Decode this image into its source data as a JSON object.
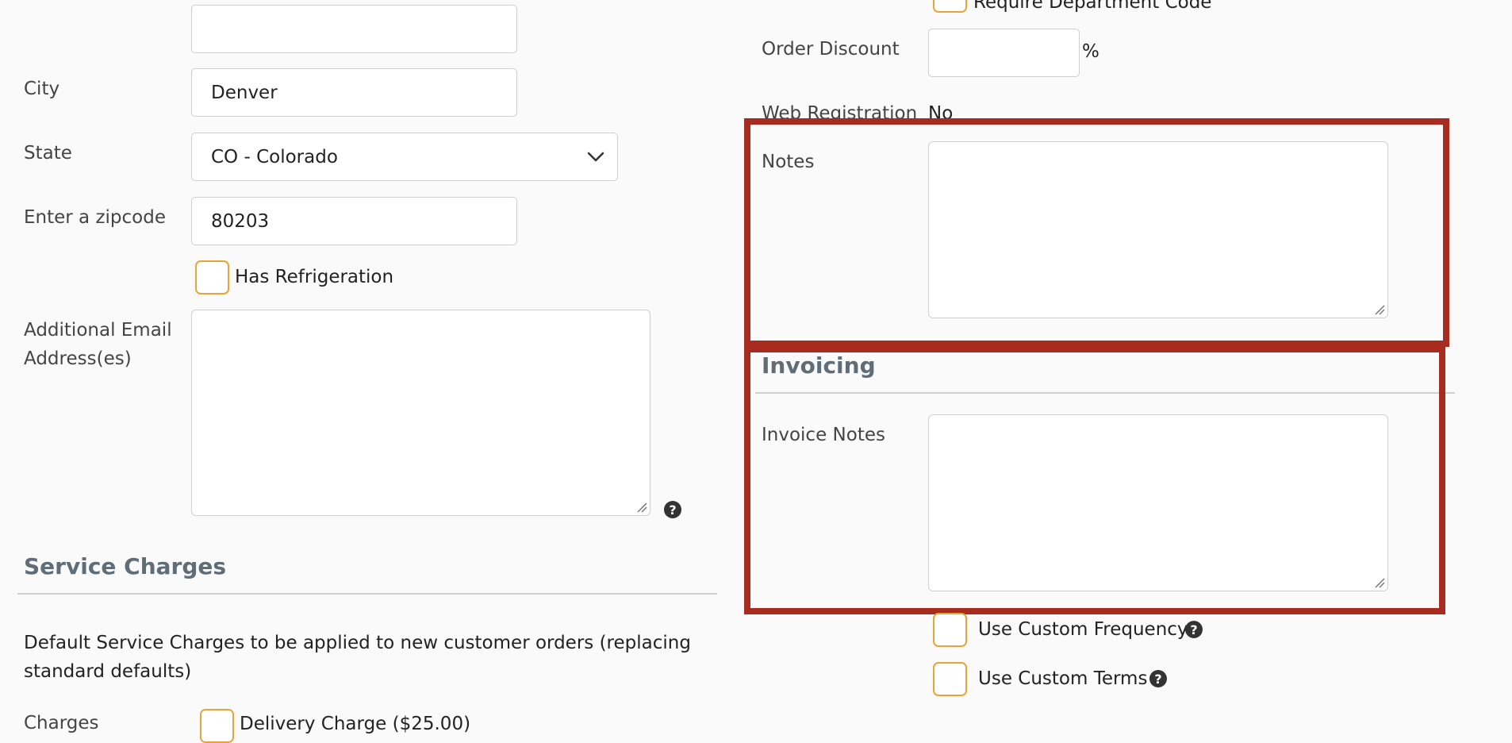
{
  "left": {
    "city": {
      "label": "City",
      "value": "Denver"
    },
    "state": {
      "label": "State",
      "value": "CO - Colorado"
    },
    "zipcode": {
      "label": "Enter a zipcode",
      "value": "80203"
    },
    "refrigeration": {
      "label": "Has Refrigeration"
    },
    "additional_email": {
      "label_line1": "Additional Email",
      "label_line2": "Address(es)"
    },
    "service_charges": {
      "heading": "Service Charges",
      "description_line1": "Default Service Charges to be applied to new customer orders (replacing",
      "description_line2": "standard defaults)",
      "charges_label": "Charges",
      "delivery_charge_label": "Delivery Charge ($25.00)"
    }
  },
  "right": {
    "require_department_code": {
      "label": "Require Department Code"
    },
    "order_discount": {
      "label": "Order Discount",
      "value": "",
      "unit": "%"
    },
    "web_registration": {
      "label": "Web Registration",
      "value": "No"
    },
    "notes": {
      "label": "Notes"
    },
    "invoicing": {
      "heading": "Invoicing",
      "invoice_notes_label": "Invoice Notes",
      "custom_frequency_label": "Use Custom Frequency",
      "custom_terms_label": "Use Custom Terms"
    }
  },
  "icons": {
    "help": "question-circle-icon",
    "dropdown": "chevron-down-icon"
  },
  "colors": {
    "highlight": "#a82b1f",
    "checkbox_border": "#e8a43a",
    "section_heading": "#5f6d78"
  }
}
